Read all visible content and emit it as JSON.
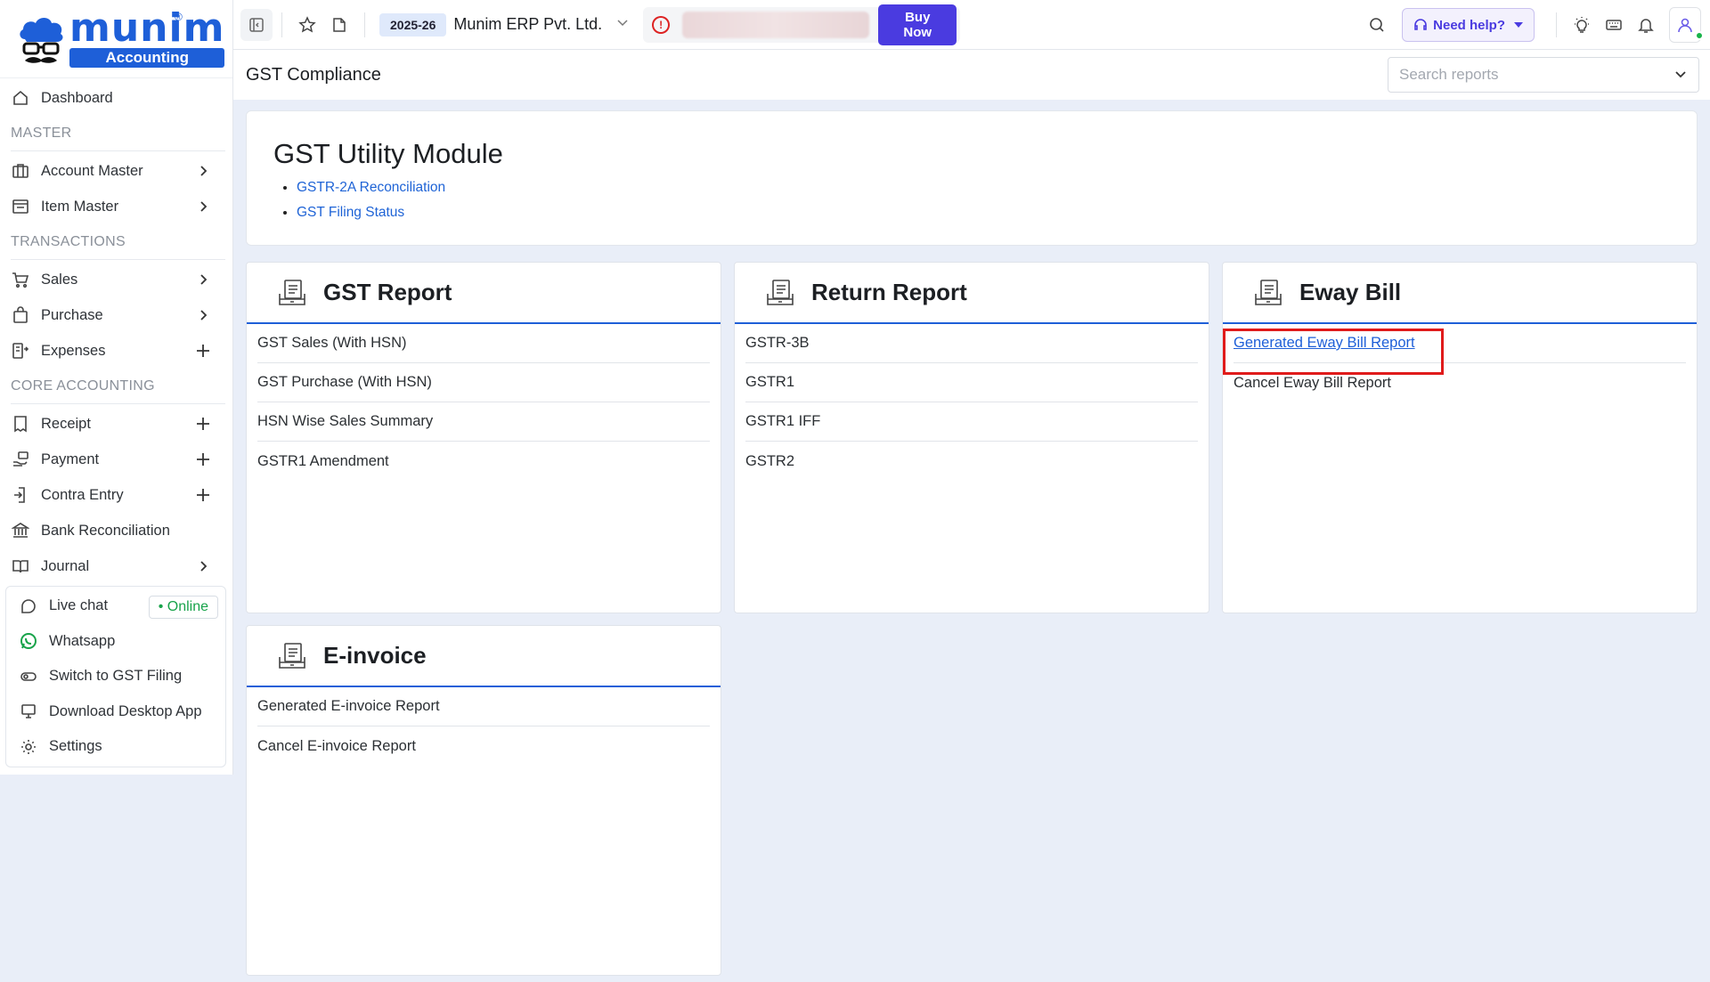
{
  "brand": {
    "word": "munim",
    "sub": "Accounting",
    "reg": "®"
  },
  "sidebar": {
    "dashboard": "Dashboard",
    "sections": {
      "master": "MASTER",
      "transactions": "TRANSACTIONS",
      "core": "CORE ACCOUNTING"
    },
    "master_items": [
      {
        "label": "Account Master",
        "trail": "chevron"
      },
      {
        "label": "Item Master",
        "trail": "chevron"
      }
    ],
    "transaction_items": [
      {
        "label": "Sales",
        "trail": "chevron"
      },
      {
        "label": "Purchase",
        "trail": "chevron"
      },
      {
        "label": "Expenses",
        "trail": "plus"
      }
    ],
    "core_items": [
      {
        "label": "Receipt",
        "trail": "plus"
      },
      {
        "label": "Payment",
        "trail": "plus"
      },
      {
        "label": "Contra Entry",
        "trail": "plus"
      },
      {
        "label": "Bank Reconciliation",
        "trail": ""
      },
      {
        "label": "Journal",
        "trail": "chevron"
      }
    ],
    "bottom": {
      "live_chat": "Live chat",
      "online": "• Online",
      "whatsapp": "Whatsapp",
      "switch_gst": "Switch to GST Filing",
      "download_app": "Download Desktop App",
      "settings": "Settings"
    }
  },
  "topbar": {
    "fy": "2025-26",
    "company": "Munim ERP Pvt. Ltd.",
    "buy_now": "Buy Now",
    "need_help": "Need help?"
  },
  "page": {
    "title": "GST Compliance",
    "search_placeholder": "Search reports"
  },
  "utility": {
    "title": "GST Utility Module",
    "links": [
      "GSTR-2A Reconciliation",
      "GST Filing Status"
    ]
  },
  "cards": {
    "gst_report": {
      "title": "GST Report",
      "items": [
        "GST Sales (With HSN)",
        "GST Purchase (With HSN)",
        "HSN Wise Sales Summary",
        "GSTR1 Amendment"
      ]
    },
    "return_report": {
      "title": "Return Report",
      "items": [
        "GSTR-3B",
        "GSTR1",
        "GSTR1 IFF",
        "GSTR2"
      ]
    },
    "eway_bill": {
      "title": "Eway Bill",
      "items": [
        "Generated Eway Bill Report",
        "Cancel Eway Bill Report"
      ]
    },
    "einvoice": {
      "title": "E-invoice",
      "items": [
        "Generated E-invoice Report",
        "Cancel E-invoice Report"
      ]
    }
  },
  "colors": {
    "accent": "#1e5fd8",
    "buy_now": "#4a3be0",
    "highlight": "#e01b1b",
    "online": "#17a34a"
  }
}
